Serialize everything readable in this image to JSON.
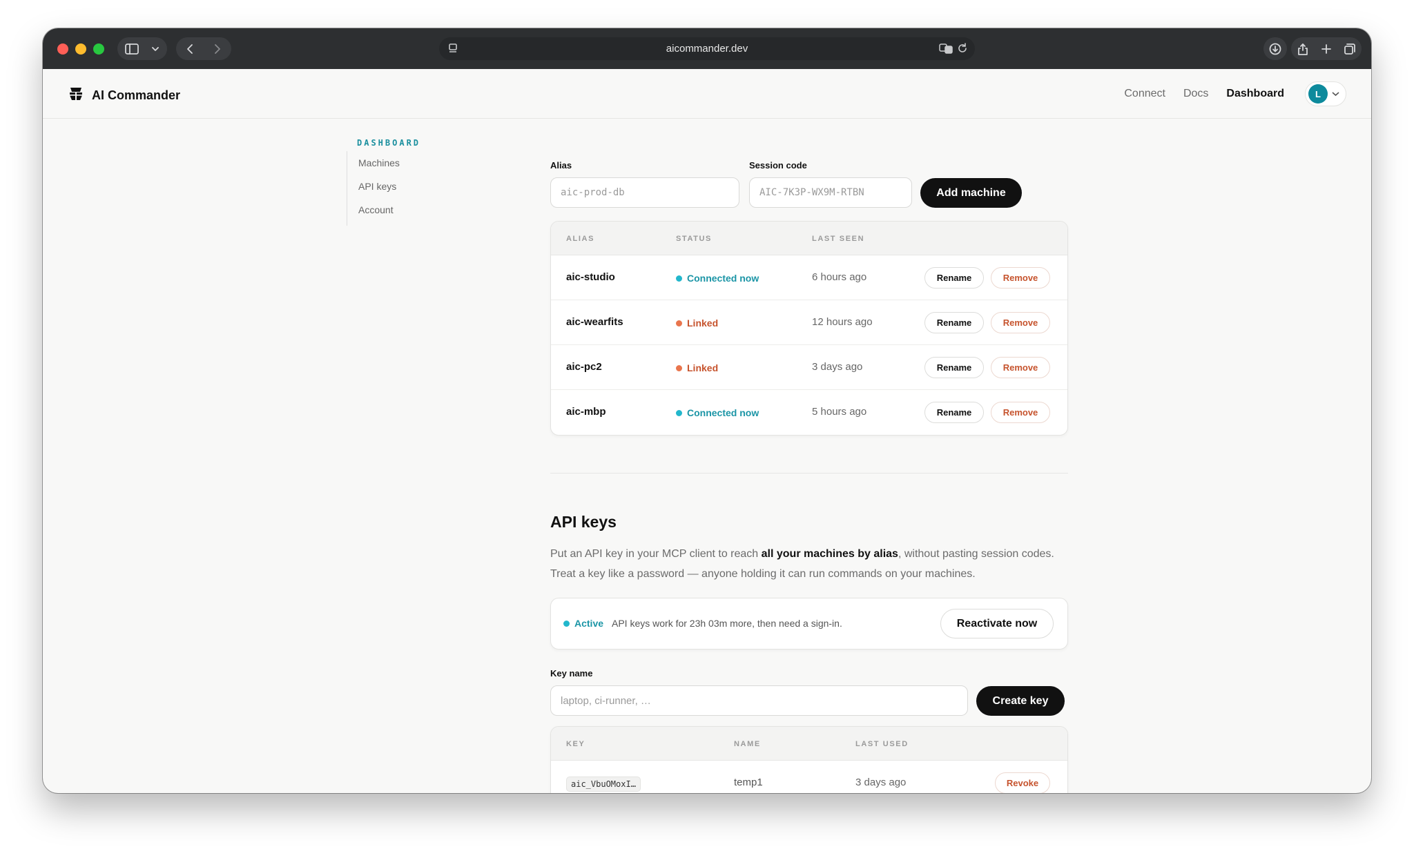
{
  "browser": {
    "url": "aicommander.dev"
  },
  "header": {
    "brand": "AI Commander",
    "nav": [
      {
        "label": "Connect"
      },
      {
        "label": "Docs"
      },
      {
        "label": "Dashboard"
      }
    ],
    "avatar_initial": "L"
  },
  "sidebar": {
    "heading": "DASHBOARD",
    "items": [
      {
        "label": "Machines"
      },
      {
        "label": "API keys"
      },
      {
        "label": "Account"
      }
    ]
  },
  "machines": {
    "alias_label": "Alias",
    "alias_placeholder": "aic-prod-db",
    "session_label": "Session code",
    "session_placeholder": "AIC-7K3P-WX9M-RTBN",
    "add_button": "Add machine",
    "columns": [
      "ALIAS",
      "STATUS",
      "LAST SEEN"
    ],
    "rows": [
      {
        "alias": "aic-studio",
        "status": "Connected now",
        "last_seen": "6 hours ago",
        "rename": "Rename",
        "remove": "Remove"
      },
      {
        "alias": "aic-wearfits",
        "status": "Linked",
        "last_seen": "12 hours ago",
        "rename": "Rename",
        "remove": "Remove"
      },
      {
        "alias": "aic-pc2",
        "status": "Linked",
        "last_seen": "3 days ago",
        "rename": "Rename",
        "remove": "Remove"
      },
      {
        "alias": "aic-mbp",
        "status": "Connected now",
        "last_seen": "5 hours ago",
        "rename": "Rename",
        "remove": "Remove"
      }
    ]
  },
  "api_keys": {
    "title": "API keys",
    "desc_pre": "Put an API key in your MCP client to reach ",
    "desc_bold": "all your machines by alias",
    "desc_post": ", without pasting session codes. Treat a key like a password — anyone holding it can run commands on your machines.",
    "notice_status": "Active",
    "notice_text": "API keys work for 23h 03m more, then need a sign-in.",
    "reactivate_button": "Reactivate now",
    "key_name_label": "Key name",
    "key_name_placeholder": "laptop, ci-runner, …",
    "create_button": "Create key",
    "columns": [
      "KEY",
      "NAME",
      "LAST USED"
    ],
    "rows": [
      {
        "key": "aic_VbuOMoxI…",
        "name": "temp1",
        "last_used": "3 days ago",
        "revoke": "Revoke"
      }
    ]
  },
  "colors": {
    "accent_teal": "#1b95a6",
    "linked_orange": "#c6532d",
    "dark_button": "#111111"
  }
}
